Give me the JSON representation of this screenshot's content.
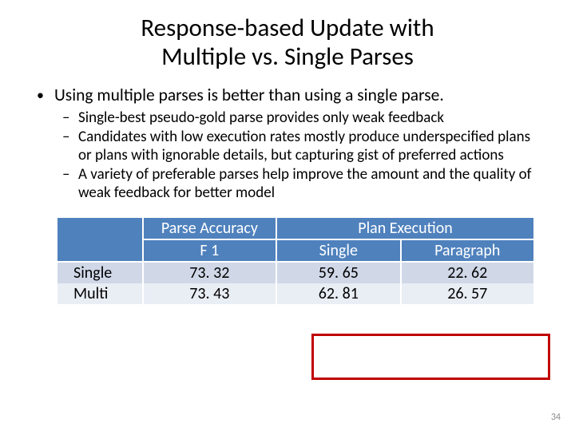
{
  "title_line1": "Response-based Update with",
  "title_line2": "Multiple vs. Single Parses",
  "bullet_top": "Using multiple parses is better than using a single parse.",
  "sub_bullets": [
    "Single-best pseudo-gold parse provides only weak feedback",
    "Candidates with low execution rates mostly produce underspecified plans or plans with ignorable details, but capturing gist of preferred actions",
    "A variety of preferable parses help improve the amount and the quality of weak feedback for better model"
  ],
  "table": {
    "head_parse": "Parse Accuracy",
    "head_f1": "F 1",
    "head_plan": "Plan Execution",
    "head_single": "Single",
    "head_paragraph": "Paragraph",
    "rows": [
      {
        "label": "Single",
        "f1": "73. 32",
        "single": "59. 65",
        "paragraph": "22. 62"
      },
      {
        "label": "Multi",
        "f1": "73. 43",
        "single": "62. 81",
        "paragraph": "26. 57"
      }
    ]
  },
  "page_number": "34",
  "chart_data": {
    "type": "table",
    "columns": [
      "",
      "Parse Accuracy F1",
      "Plan Execution Single",
      "Plan Execution Paragraph"
    ],
    "rows": [
      [
        "Single",
        73.32,
        59.65,
        22.62
      ],
      [
        "Multi",
        73.43,
        62.81,
        26.57
      ]
    ],
    "highlight_columns": [
      "Plan Execution Single",
      "Plan Execution Paragraph"
    ]
  }
}
